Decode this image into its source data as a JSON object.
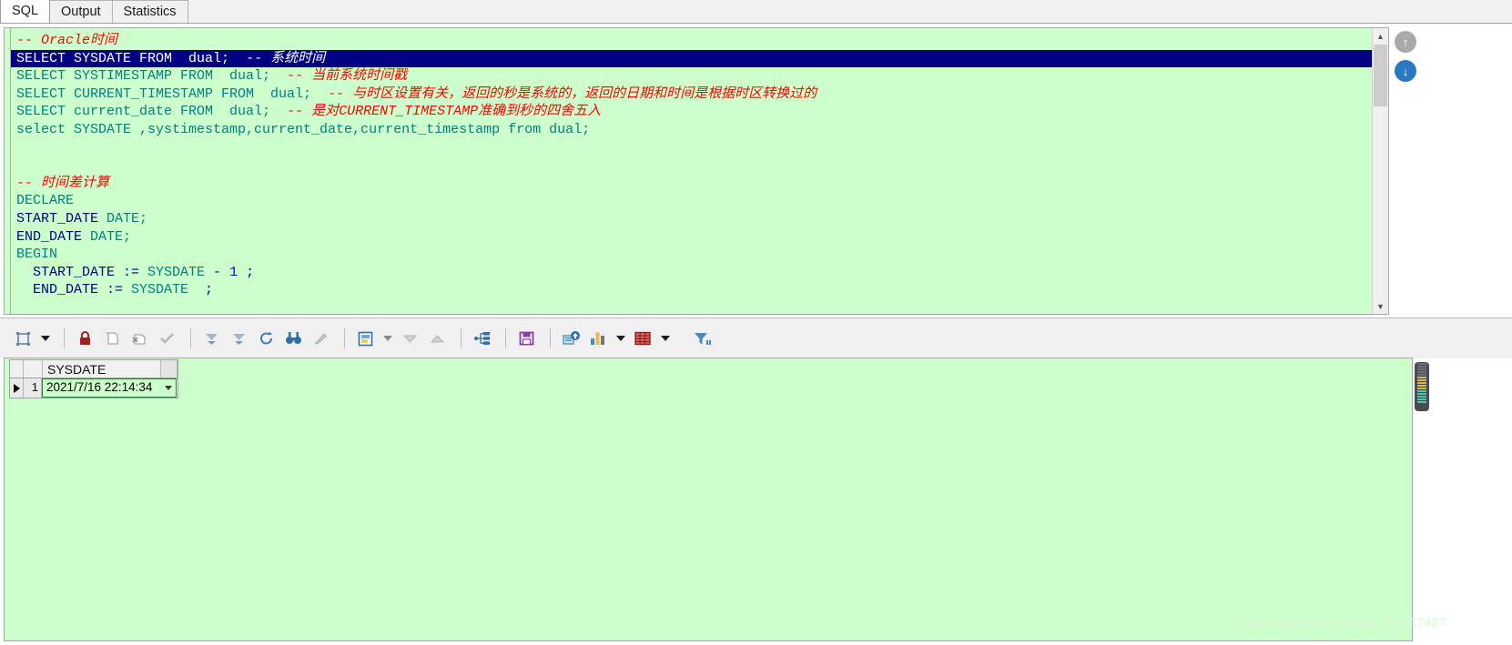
{
  "tabs": [
    {
      "label": "SQL",
      "active": true
    },
    {
      "label": "Output",
      "active": false
    },
    {
      "label": "Statistics",
      "active": false
    }
  ],
  "editor": {
    "lines": [
      {
        "selected": false,
        "tokens": [
          {
            "cls": "cmt",
            "text": "-- Oracle时间"
          }
        ]
      },
      {
        "selected": true,
        "tokens": [
          {
            "cls": "kw-dark",
            "text": "SELECT SYSDATE FROM  dual;"
          },
          {
            "cls": "plain",
            "text": "  "
          },
          {
            "cls": "cmt",
            "text": "-- 系统时间"
          }
        ]
      },
      {
        "selected": false,
        "tokens": [
          {
            "cls": "kw",
            "text": "SELECT SYSTIMESTAMP FROM  dual;"
          },
          {
            "cls": "plain",
            "text": "  "
          },
          {
            "cls": "cmt",
            "text": "-- 当前系统时间戳"
          }
        ]
      },
      {
        "selected": false,
        "tokens": [
          {
            "cls": "kw",
            "text": "SELECT CURRENT_TIMESTAMP FROM  dual;"
          },
          {
            "cls": "plain",
            "text": "  "
          },
          {
            "cls": "cmt",
            "text": "-- 与时区设置有关，返回的秒是系统的，返回的日期和时间是根据时区转换过的"
          }
        ]
      },
      {
        "selected": false,
        "tokens": [
          {
            "cls": "kw",
            "text": "SELECT current_date FROM  dual;"
          },
          {
            "cls": "plain",
            "text": "  "
          },
          {
            "cls": "cmt",
            "text": "-- 是对CURRENT_TIMESTAMP准确到秒的四舍五入"
          }
        ]
      },
      {
        "selected": false,
        "tokens": [
          {
            "cls": "kw",
            "text": "select SYSDATE ,systimestamp,current_date,current_timestamp from dual;"
          }
        ]
      },
      {
        "selected": false,
        "tokens": [
          {
            "cls": "plain",
            "text": ""
          }
        ]
      },
      {
        "selected": false,
        "tokens": [
          {
            "cls": "plain",
            "text": ""
          }
        ]
      },
      {
        "selected": false,
        "tokens": [
          {
            "cls": "cmt",
            "text": "-- 时间差计算"
          }
        ]
      },
      {
        "selected": false,
        "tokens": [
          {
            "cls": "kw",
            "text": "DECLARE"
          }
        ]
      },
      {
        "selected": false,
        "tokens": [
          {
            "cls": "kw-dark",
            "text": "START_DATE "
          },
          {
            "cls": "kw",
            "text": "DATE;"
          }
        ]
      },
      {
        "selected": false,
        "tokens": [
          {
            "cls": "kw-dark",
            "text": "END_DATE "
          },
          {
            "cls": "kw",
            "text": "DATE;"
          }
        ]
      },
      {
        "selected": false,
        "tokens": [
          {
            "cls": "kw",
            "text": "BEGIN"
          }
        ]
      },
      {
        "selected": false,
        "tokens": [
          {
            "cls": "kw-dark",
            "text": "  START_DATE := "
          },
          {
            "cls": "kw",
            "text": "SYSDATE "
          },
          {
            "cls": "kw-dark",
            "text": "- "
          },
          {
            "cls": "num",
            "text": "1"
          },
          {
            "cls": "kw-dark",
            "text": " ;"
          }
        ]
      },
      {
        "selected": false,
        "tokens": [
          {
            "cls": "kw-dark",
            "text": "  END_DATE := "
          },
          {
            "cls": "kw",
            "text": "SYSDATE"
          },
          {
            "cls": "kw-dark",
            "text": "  ;"
          }
        ]
      }
    ]
  },
  "nav": {
    "up_label": "↑",
    "down_label": "↓"
  },
  "toolbar": {
    "items": [
      {
        "name": "commit-structure-icon",
        "caret": true
      },
      {
        "name": "lock-icon"
      },
      {
        "name": "new-record-icon"
      },
      {
        "name": "delete-record-icon"
      },
      {
        "name": "post-edit-icon"
      },
      {
        "name": "first-record-icon"
      },
      {
        "name": "last-record-icon"
      },
      {
        "name": "refresh-icon"
      },
      {
        "name": "find-icon"
      },
      {
        "name": "clear-filter-icon"
      },
      {
        "name": "export-data-icon",
        "caret_gray": true
      },
      {
        "name": "collapse-icon"
      },
      {
        "name": "expand-icon"
      },
      {
        "name": "link-tree-icon"
      },
      {
        "name": "save-icon"
      },
      {
        "name": "export-file-icon"
      },
      {
        "name": "chart-icon",
        "caret": true
      },
      {
        "name": "grid-icon",
        "caret": true
      },
      {
        "name": "filter-icon"
      }
    ]
  },
  "result_grid": {
    "columns": [
      "SYSDATE"
    ],
    "rows": [
      {
        "row_number": "1",
        "cells": [
          "2021/7/16 22:14:34"
        ]
      }
    ]
  },
  "watermark": {
    "text": "https://blog.csdn.net/qq_47647487"
  }
}
